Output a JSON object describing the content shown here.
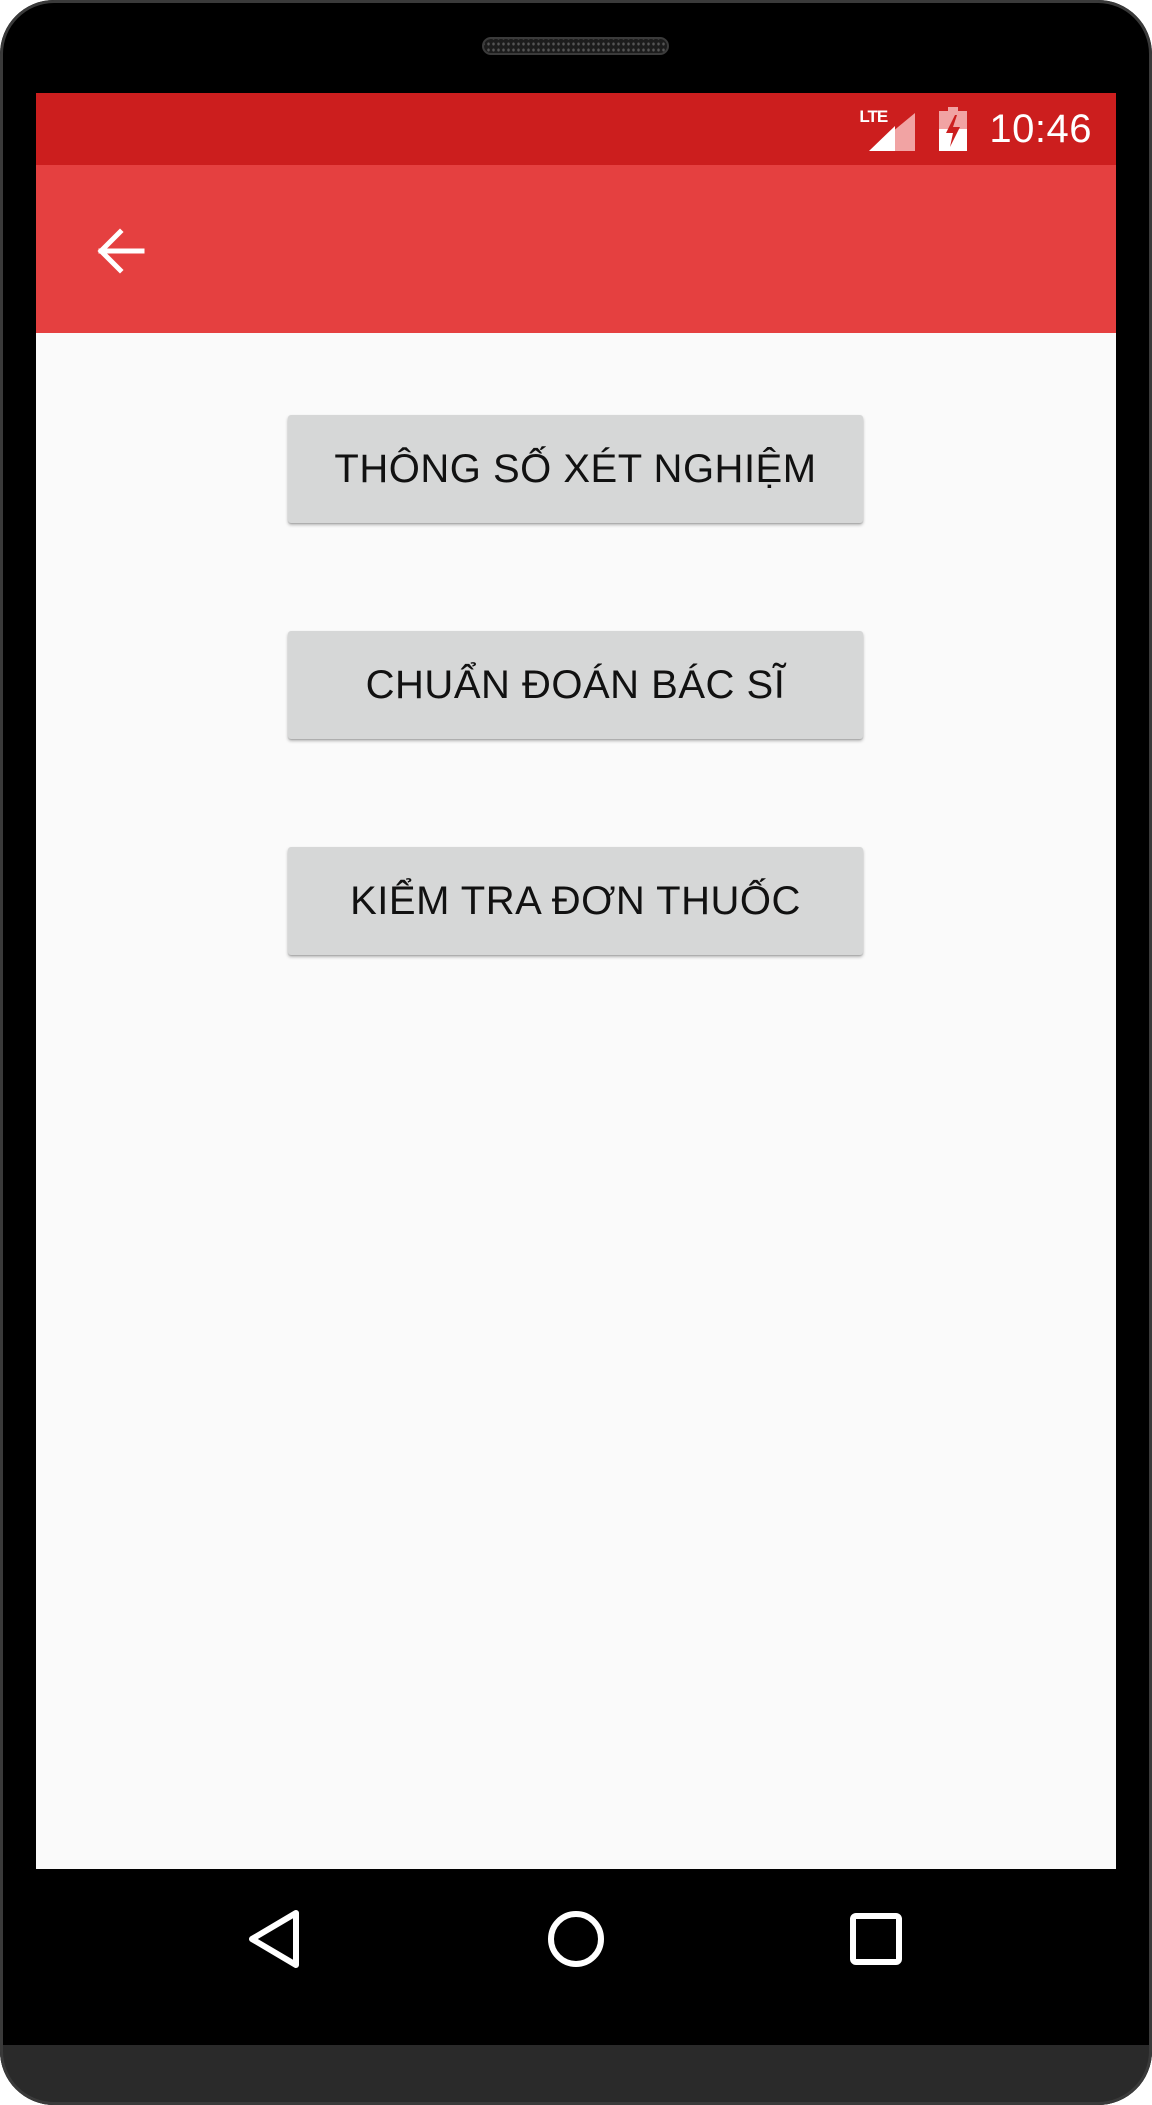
{
  "status_bar": {
    "time": "10:46",
    "network_label": "LTE",
    "network_icon": "signal-icon",
    "battery_icon": "battery-charging-icon",
    "background_color": "#cc1e1e"
  },
  "app_bar": {
    "back_icon": "arrow-back-icon",
    "background_color": "#e54040"
  },
  "main": {
    "buttons": [
      {
        "label": "THÔNG SỐ XÉT NGHIỆM"
      },
      {
        "label": "CHUẨN ĐOÁN BÁC SĨ"
      },
      {
        "label": "KIỂM TRA ĐƠN THUỐC"
      }
    ]
  },
  "nav_bar": {
    "back_icon": "nav-back-icon",
    "home_icon": "nav-home-icon",
    "recents_icon": "nav-recents-icon"
  }
}
